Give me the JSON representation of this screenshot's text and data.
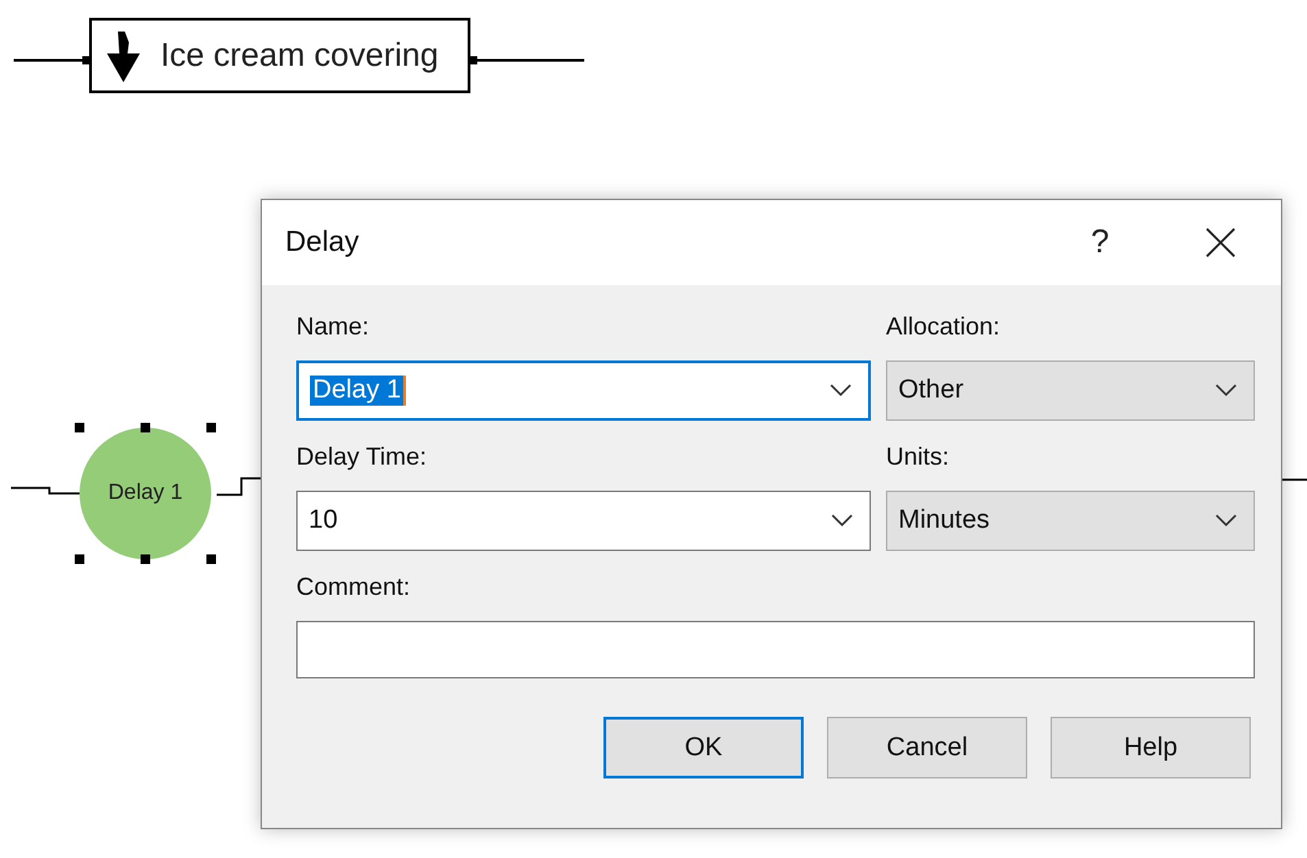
{
  "diagram": {
    "activity": {
      "label": "Ice cream covering"
    },
    "delay_node": {
      "label": "Delay 1",
      "selected": true
    }
  },
  "dialog": {
    "title": "Delay",
    "help": "?",
    "fields": [
      {
        "label": "Name:",
        "value": "Delay 1",
        "kind": "combo",
        "focused": true,
        "text_selected": true
      },
      {
        "label": "Allocation:",
        "value": "Other",
        "kind": "dropdown",
        "focused": false,
        "text_selected": false
      },
      {
        "label": "Delay Time:",
        "value": "10",
        "kind": "combo",
        "focused": false,
        "text_selected": false
      },
      {
        "label": "Units:",
        "value": "Minutes",
        "kind": "dropdown",
        "focused": false,
        "text_selected": false
      }
    ],
    "comment": {
      "label": "Comment:"
    },
    "buttons": [
      {
        "label": "OK",
        "default": true
      },
      {
        "label": "Cancel",
        "default": false
      },
      {
        "label": "Help",
        "default": false
      }
    ]
  }
}
